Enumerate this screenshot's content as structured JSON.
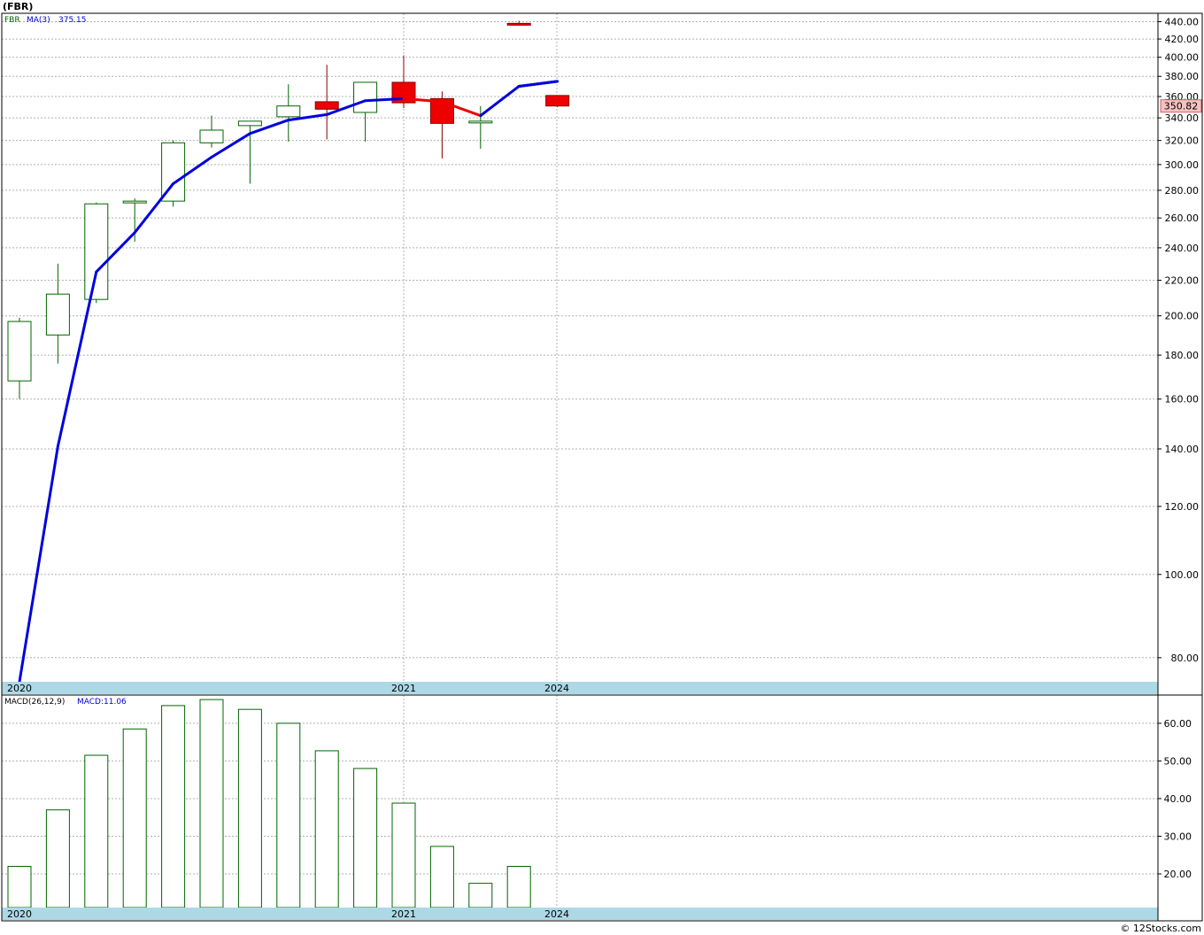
{
  "title": "(FBR)",
  "watermark": "© 12Stocks.com",
  "colors": {
    "up": "#006400",
    "down": "#ee0000",
    "ma_up": "#0000dd",
    "ma_down": "#ee0000",
    "axis_band": "#add8e6",
    "price_flag_bg": "#f4c2c2"
  },
  "chart_data": [
    {
      "type": "candlestick",
      "name": "price",
      "legend": {
        "symbol": "FBR",
        "ma_label": "MA(3)",
        "ma_value": "375.15"
      },
      "last_price_label": "350.82",
      "y_scale": "log",
      "ylim": [
        75,
        450
      ],
      "y_ticks": [
        "80.00",
        "100.00",
        "120.00",
        "140.00",
        "160.00",
        "180.00",
        "200.00",
        "220.00",
        "240.00",
        "260.00",
        "280.00",
        "300.00",
        "320.00",
        "340.00",
        "360.00",
        "380.00",
        "400.00",
        "420.00",
        "440.00"
      ],
      "x_labels": [
        "2020",
        "2021",
        "2024"
      ],
      "candles": [
        {
          "o": 168,
          "h": 199,
          "l": 160,
          "c": 197
        },
        {
          "o": 190,
          "h": 230,
          "l": 176,
          "c": 212
        },
        {
          "o": 209,
          "h": 271,
          "l": 207,
          "c": 270
        },
        {
          "o": 272,
          "h": 274,
          "l": 244,
          "c": 272
        },
        {
          "o": 272,
          "h": 320,
          "l": 268,
          "c": 318
        },
        {
          "o": 318,
          "h": 342,
          "l": 314,
          "c": 329
        },
        {
          "o": 333,
          "h": 337,
          "l": 285,
          "c": 337
        },
        {
          "o": 341,
          "h": 372,
          "l": 319,
          "c": 351
        },
        {
          "o": 355,
          "h": 392,
          "l": 321,
          "c": 348
        },
        {
          "o": 345,
          "h": 374,
          "l": 319,
          "c": 374
        },
        {
          "o": 374,
          "h": 402,
          "l": 349,
          "c": 354
        },
        {
          "o": 358,
          "h": 365,
          "l": 305,
          "c": 335
        },
        {
          "o": 336,
          "h": 351,
          "l": 313,
          "c": 337
        },
        {
          "o": 438,
          "h": 441,
          "l": 436,
          "c": 437
        },
        {
          "o": 361,
          "h": 361,
          "l": 350,
          "c": 351
        }
      ],
      "ma": [
        74,
        141,
        225,
        250,
        285,
        306,
        326,
        338,
        343,
        356,
        358,
        355,
        342,
        370,
        375
      ]
    },
    {
      "type": "bar",
      "name": "macd",
      "legend": {
        "label": "MACD(26,12,9)",
        "value_label": "MACD:11.06"
      },
      "ylim": [
        11.06,
        67.5
      ],
      "y_ticks": [
        "20.00",
        "30.00",
        "40.00",
        "50.00",
        "60.00"
      ],
      "x_labels": [
        "2020",
        "2021",
        "2024"
      ],
      "values": [
        22,
        37,
        51.5,
        58.5,
        64.7,
        66.3,
        63.7,
        60,
        52.7,
        48,
        38.8,
        27.3,
        17.5,
        22
      ]
    }
  ]
}
